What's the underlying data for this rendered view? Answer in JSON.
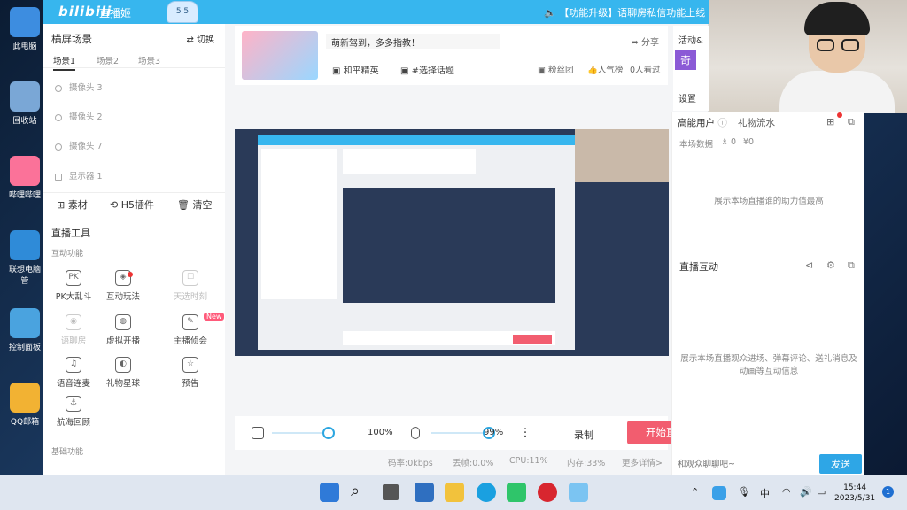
{
  "desktop": {
    "icons": [
      "此电脑",
      "回收站",
      "哔哩哔哩",
      "联想电脑管",
      "控制面板",
      "QQ邮箱"
    ]
  },
  "app": {
    "logo": "bilibili",
    "title": "直播姬",
    "mascot": "5 5",
    "notice": "🔈 【功能升级】语聊房私信功能上线"
  },
  "scenes": {
    "heading": "横屏场景",
    "switch_label": "切换",
    "tabs": [
      "场景1",
      "场景2",
      "场景3"
    ],
    "sources": [
      "摄像头 3",
      "摄像头 2",
      "摄像头 7",
      "显示器 1"
    ],
    "buttons": [
      "素材",
      "H5插件",
      "清空"
    ]
  },
  "tools": {
    "heading": "直播工具",
    "subheading": "互动功能",
    "items": [
      {
        "label": "PK大乱斗",
        "icon": "PK",
        "dim": false
      },
      {
        "label": "互动玩法",
        "icon": "◈",
        "dim": false
      },
      {
        "label": "天选时刻",
        "icon": "☐",
        "dim": true
      },
      {
        "label": "语聊房",
        "icon": "◉",
        "dim": true
      },
      {
        "label": "虚拟开播",
        "icon": "◍",
        "dim": false
      },
      {
        "label": "主播侦会",
        "icon": "✎",
        "dim": false
      },
      {
        "label": "语音连麦",
        "icon": "♫",
        "dim": false
      },
      {
        "label": "礼物星球",
        "icon": "◐",
        "dim": false
      },
      {
        "label": "预告",
        "icon": "☆",
        "dim": false
      },
      {
        "label": "航海回顾",
        "icon": "⚓",
        "dim": false
      }
    ],
    "new_badge": "New",
    "basic_heading": "基础功能"
  },
  "room": {
    "title_input": "萌新驾到，多多指教！",
    "share_label": "分享",
    "category": "和平精英",
    "topic": "#选择话题",
    "fan_group": "粉丝团",
    "popularity": "人气榜",
    "viewers": "0人看过"
  },
  "controls": {
    "speaker_volume": "100%",
    "speaker_level": 1.0,
    "mic_volume": "99%",
    "mic_level": 0.99,
    "record_label": "录制",
    "start_label": "开始直播"
  },
  "status": {
    "bitrate": "码率:0kbps",
    "drop": "丢帧:0.0%",
    "cpu": "CPU:11%",
    "memory": "内存:33%",
    "more": "更多详情>"
  },
  "activity": {
    "label": "活动&",
    "badge": "奇",
    "settings": "设置"
  },
  "right": {
    "tab_users": "高能用户",
    "tab_gifts": "礼物流水",
    "stats": "本场数据",
    "stat_users": "0",
    "stat_money": "¥0",
    "empty_text": "展示本场直播谁的助力值最高",
    "interact_head": "直播互动",
    "interact_empty": "展示本场直播观众进场、弹幕评论、送礼消息及动画等互动信息",
    "send_placeholder": "和观众聊聊吧~",
    "send_label": "发送"
  },
  "taskbar": {
    "ime": "中",
    "time": "15:44",
    "date": "2023/5/31",
    "notif": "1"
  }
}
